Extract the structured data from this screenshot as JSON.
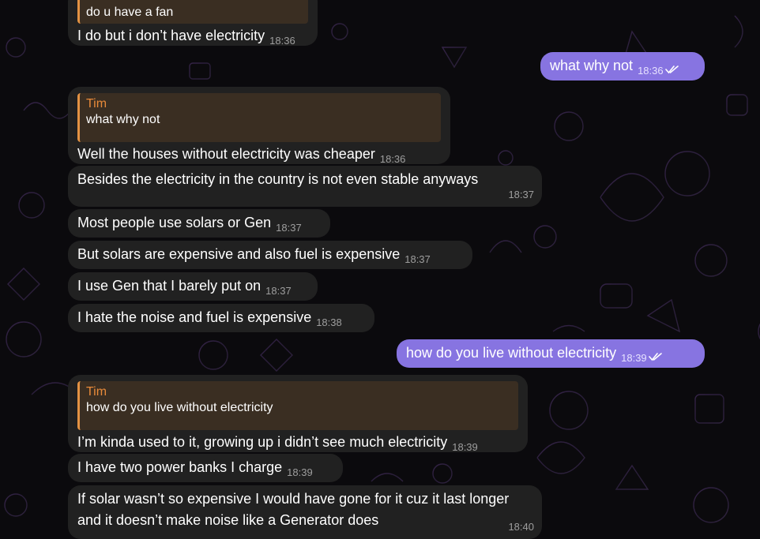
{
  "colors": {
    "incoming": "#212121",
    "outgoing": "#8774e1",
    "reply_accent": "#e39243",
    "background": "#0b0a0d"
  },
  "messages": [
    {
      "dir": "in",
      "reply": {
        "quote": "do u have a fan"
      },
      "text": "I do but i don’t have electricity",
      "time": "18:36"
    },
    {
      "dir": "out",
      "text": "what why not",
      "time": "18:36",
      "status": "double-check-icon"
    },
    {
      "dir": "in",
      "reply": {
        "name": "Tim",
        "quote": "what why not"
      },
      "text": "Well the houses without electricity was cheaper",
      "time": "18:36"
    },
    {
      "dir": "in",
      "text": "Besides the electricity in the country is not even stable anyways",
      "time": "18:37"
    },
    {
      "dir": "in",
      "text": "Most people use solars or Gen",
      "time": "18:37"
    },
    {
      "dir": "in",
      "text": "But solars are expensive and also fuel is expensive",
      "time": "18:37"
    },
    {
      "dir": "in",
      "text": "I use Gen that I barely put on",
      "time": "18:37"
    },
    {
      "dir": "in",
      "text": "I hate the noise and fuel is expensive",
      "time": "18:38"
    },
    {
      "dir": "out",
      "text": "how do you live without electricity",
      "time": "18:39",
      "status": "double-check-icon"
    },
    {
      "dir": "in",
      "reply": {
        "name": "Tim",
        "quote": "how do you live without electricity"
      },
      "text": "I’m kinda used to it, growing up i didn’t see much electricity",
      "time": "18:39"
    },
    {
      "dir": "in",
      "text": "I have two power banks I charge",
      "time": "18:39"
    },
    {
      "dir": "in",
      "text": "If solar wasn’t so expensive I would have gone for it cuz it last longer and it doesn’t make noise like a Generator does",
      "time": "18:40"
    }
  ]
}
